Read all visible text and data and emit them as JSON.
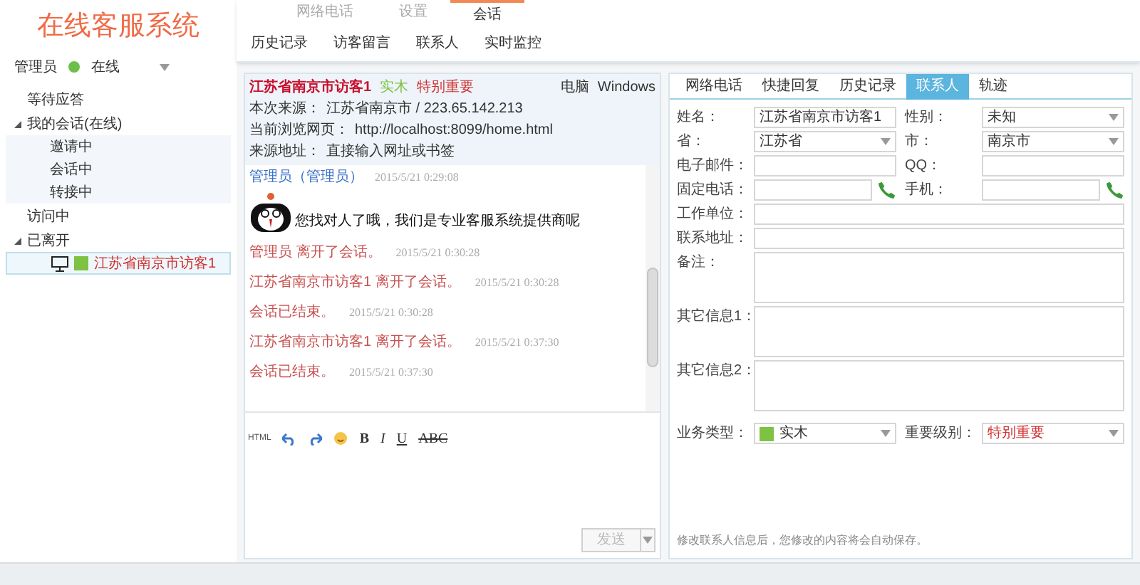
{
  "app_title": "在线客服系统",
  "user": {
    "name": "管理员",
    "status": "在线"
  },
  "tree": [
    {
      "label": "等待应答",
      "selected": false
    },
    {
      "label": "我的会话(在线)",
      "selected": false,
      "expanded": true,
      "children": [
        {
          "label": "邀请中",
          "selected": false
        },
        {
          "label": "会话中",
          "selected": false
        },
        {
          "label": "转接中",
          "selected": false
        }
      ]
    },
    {
      "label": "访问中",
      "selected": false
    },
    {
      "label": "已离开",
      "selected": false,
      "expanded": true,
      "children": [
        {
          "label": "江苏省南京市访客1",
          "kind": "visitor",
          "selected": true
        }
      ]
    }
  ],
  "top_tabs": [
    {
      "label": "网络电话",
      "selected": false
    },
    {
      "label": "设置",
      "selected": false
    },
    {
      "label": "会话",
      "selected": true
    }
  ],
  "sub_tabs": [
    "历史记录",
    "访客留言",
    "联系人",
    "实时监控"
  ],
  "visitor": {
    "name": "江苏省南京市访客1",
    "category": "实木",
    "importance": "特别重要",
    "device": "电脑",
    "os": "Windows",
    "info": [
      {
        "label": "本次来源：",
        "value": "江苏省南京市 / 223.65.142.213"
      },
      {
        "label": "当前浏览网页：",
        "value": "http://localhost:8099/home.html"
      },
      {
        "label": "来源地址：",
        "value": "直接输入网址或书签"
      }
    ]
  },
  "messages": [
    {
      "kind": "text",
      "sender": "管理员（管理员）",
      "time": "2015/5/21 0:29:08",
      "text": "您找对人了哦，我们是专业客服系统提供商呢"
    },
    {
      "kind": "system",
      "text": "管理员 离开了会话。",
      "time": "2015/5/21 0:30:28"
    },
    {
      "kind": "system",
      "text": "江苏省南京市访客1 离开了会话。",
      "time": "2015/5/21 0:30:28"
    },
    {
      "kind": "system",
      "text": "会话已结束。",
      "time": "2015/5/21 0:30:28"
    },
    {
      "kind": "system",
      "text": "江苏省南京市访客1 离开了会话。",
      "time": "2015/5/21 0:37:30"
    },
    {
      "kind": "system",
      "text": "会话已结束。",
      "time": "2015/5/21 0:37:30"
    }
  ],
  "html_button": "HTML",
  "format_buttons": [
    "B",
    "I",
    "U",
    "ABC"
  ],
  "send_button": {
    "label": "发送",
    "disabled": true
  },
  "side_tabs": [
    {
      "label": "网络电话",
      "selected": false
    },
    {
      "label": "快捷回复",
      "selected": false
    },
    {
      "label": "历史记录",
      "selected": false
    },
    {
      "label": "联系人",
      "selected": true
    },
    {
      "label": "轨迹",
      "selected": false
    }
  ],
  "contact_rows": [
    [
      {
        "label": "姓名：",
        "kind": "text",
        "value": "江苏省南京市访客1"
      },
      {
        "label": "性别：",
        "kind": "select",
        "value": "未知"
      }
    ],
    [
      {
        "label": "省：",
        "kind": "select",
        "value": "江苏省"
      },
      {
        "label": "市：",
        "kind": "select",
        "value": "南京市"
      }
    ],
    [
      {
        "label": "电子邮件：",
        "kind": "text"
      },
      {
        "label": "QQ：",
        "kind": "text"
      }
    ],
    [
      {
        "label": "固定电话：",
        "kind": "phone"
      },
      {
        "label": "手机：",
        "kind": "phone"
      }
    ],
    [
      {
        "label": "工作单位：",
        "kind": "text"
      }
    ],
    [
      {
        "label": "联系地址：",
        "kind": "text"
      }
    ],
    [
      {
        "label": "备注：",
        "kind": "textarea"
      }
    ],
    [
      {
        "label": "其它信息1：",
        "kind": "textarea"
      }
    ],
    [
      {
        "label": "其它信息2：",
        "kind": "textarea"
      }
    ],
    [
      {
        "label": "业务类型：",
        "kind": "swatch_select",
        "value": "实木"
      },
      {
        "label": "重要级别：",
        "kind": "level_select",
        "value": "特别重要"
      }
    ]
  ],
  "note": "修改联系人信息后，您修改的内容将会自动保存。"
}
